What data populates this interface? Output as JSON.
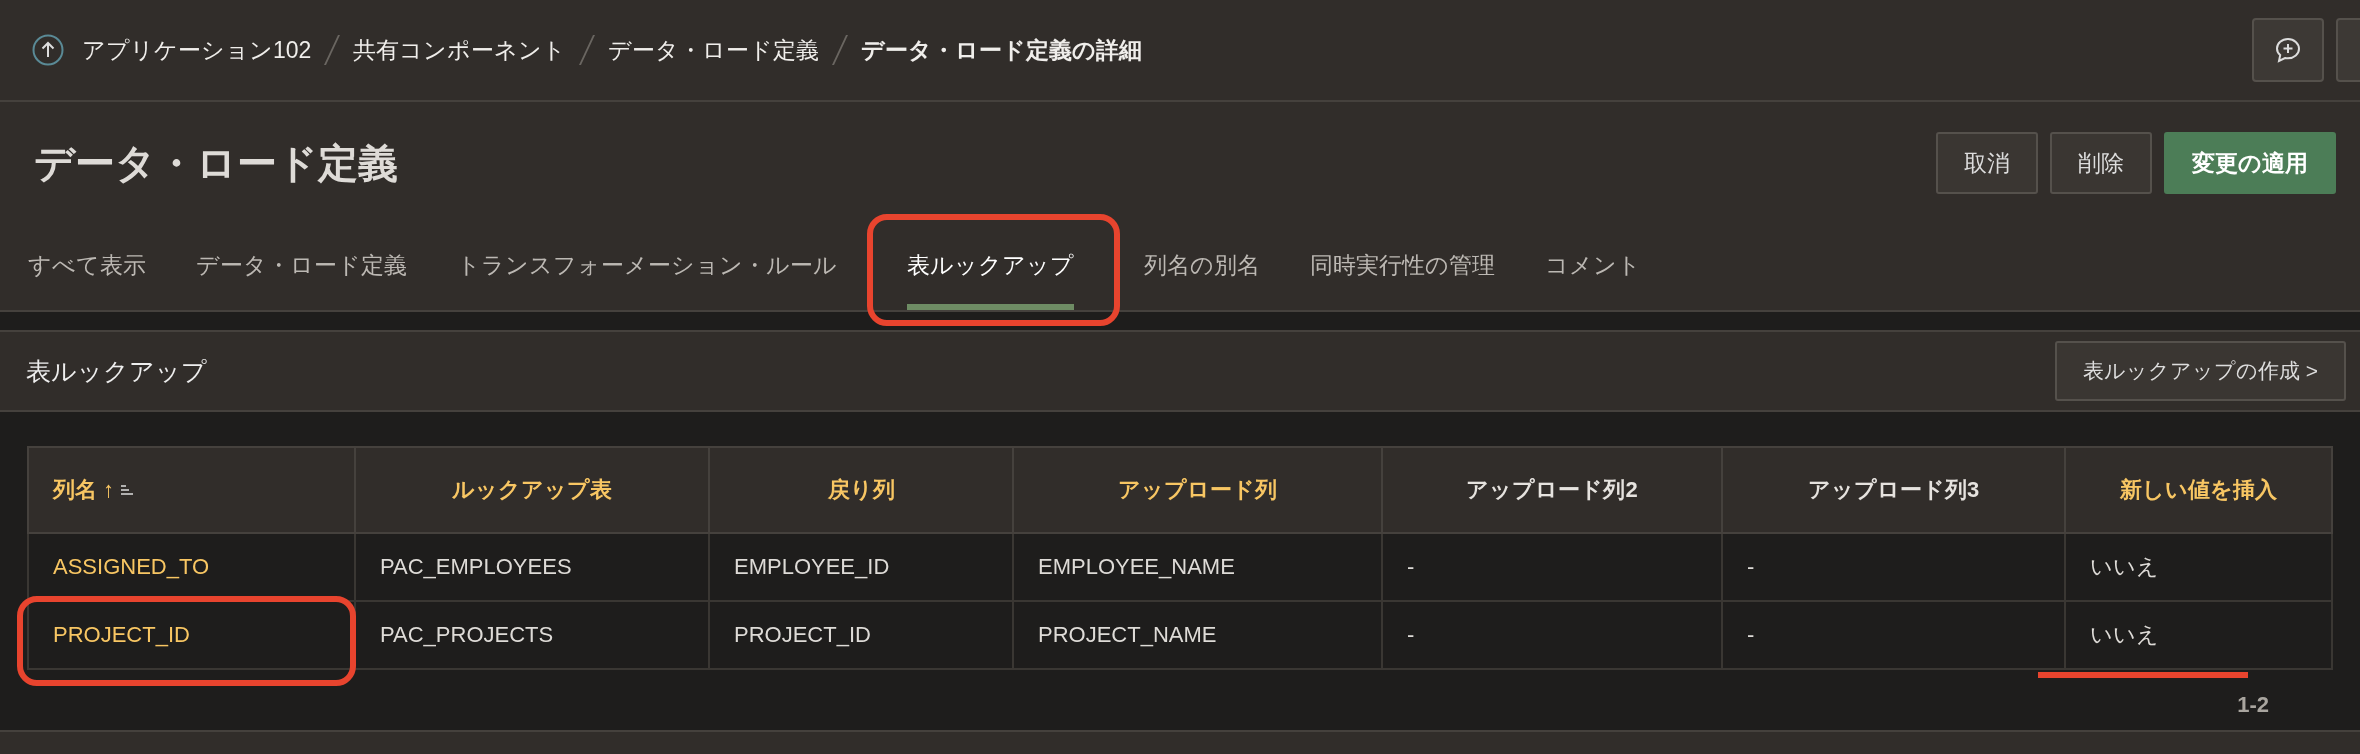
{
  "breadcrumb": {
    "items": [
      {
        "label": "アプリケーション102",
        "current": false
      },
      {
        "label": "共有コンポーネント",
        "current": false
      },
      {
        "label": "データ・ロード定義",
        "current": false
      },
      {
        "label": "データ・ロード定義の詳細",
        "current": true
      }
    ]
  },
  "page": {
    "title": "データ・ロード定義",
    "buttons": [
      {
        "label": "取消",
        "kind": "secondary"
      },
      {
        "label": "削除",
        "kind": "secondary"
      },
      {
        "label": "変更の適用",
        "kind": "primary"
      }
    ]
  },
  "tabs": [
    {
      "label": "すべて表示",
      "selected": false,
      "annotated": false
    },
    {
      "label": "データ・ロード定義",
      "selected": false,
      "annotated": false
    },
    {
      "label": "トランスフォーメーション・ルール",
      "selected": false,
      "annotated": false
    },
    {
      "label": "表ルックアップ",
      "selected": true,
      "annotated": true
    },
    {
      "label": "列名の別名",
      "selected": false,
      "annotated": false
    },
    {
      "label": "同時実行性の管理",
      "selected": false,
      "annotated": false
    },
    {
      "label": "コメント",
      "selected": false,
      "annotated": false
    }
  ],
  "region": {
    "title": "表ルックアップ",
    "create_button": "表ルックアップの作成 >"
  },
  "table": {
    "columns": [
      {
        "label": "列名 ↑",
        "highlighted": true,
        "sorted": true
      },
      {
        "label": "ルックアップ表",
        "highlighted": true,
        "sorted": false
      },
      {
        "label": "戻り列",
        "highlighted": true,
        "sorted": false
      },
      {
        "label": "アップロード列",
        "highlighted": true,
        "sorted": false
      },
      {
        "label": "アップロード列2",
        "highlighted": false,
        "sorted": false
      },
      {
        "label": "アップロード列3",
        "highlighted": false,
        "sorted": false
      },
      {
        "label": "新しい値を挿入",
        "highlighted": true,
        "sorted": false
      }
    ],
    "rows": [
      {
        "cells": [
          {
            "text": "ASSIGNED_TO",
            "circled": false,
            "underlined": false
          },
          {
            "text": "PAC_EMPLOYEES",
            "circled": false,
            "underlined": false
          },
          {
            "text": "EMPLOYEE_ID",
            "circled": false,
            "underlined": false
          },
          {
            "text": "EMPLOYEE_NAME",
            "circled": false,
            "underlined": false
          },
          {
            "text": "-",
            "circled": false,
            "underlined": false
          },
          {
            "text": "-",
            "circled": false,
            "underlined": false
          },
          {
            "text": "いいえ",
            "circled": false,
            "underlined": false
          }
        ]
      },
      {
        "cells": [
          {
            "text": "PROJECT_ID",
            "circled": true,
            "underlined": false
          },
          {
            "text": "PAC_PROJECTS",
            "circled": false,
            "underlined": false
          },
          {
            "text": "PROJECT_ID",
            "circled": false,
            "underlined": false
          },
          {
            "text": "PROJECT_NAME",
            "circled": false,
            "underlined": false
          },
          {
            "text": "-",
            "circled": false,
            "underlined": false
          },
          {
            "text": "-",
            "circled": false,
            "underlined": false
          },
          {
            "text": "いいえ",
            "circled": false,
            "underlined": true
          }
        ]
      }
    ],
    "pagination": "1-2"
  }
}
